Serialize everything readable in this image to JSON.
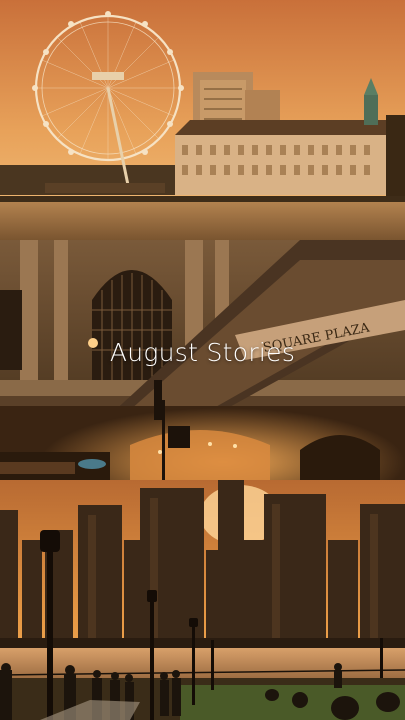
{
  "reel": {
    "title": "August Stories",
    "sign_text": "SQUARE PLAZA"
  },
  "panels": [
    {
      "scene": "london-eye-riverside"
    },
    {
      "scene": "station-arcade"
    },
    {
      "scene": "city-skyline-waterfront"
    }
  ],
  "colors": {
    "sunset_orange": "#e89a45",
    "warm_stone": "#c49a6a",
    "deep_shadow": "#2a1a0c"
  }
}
